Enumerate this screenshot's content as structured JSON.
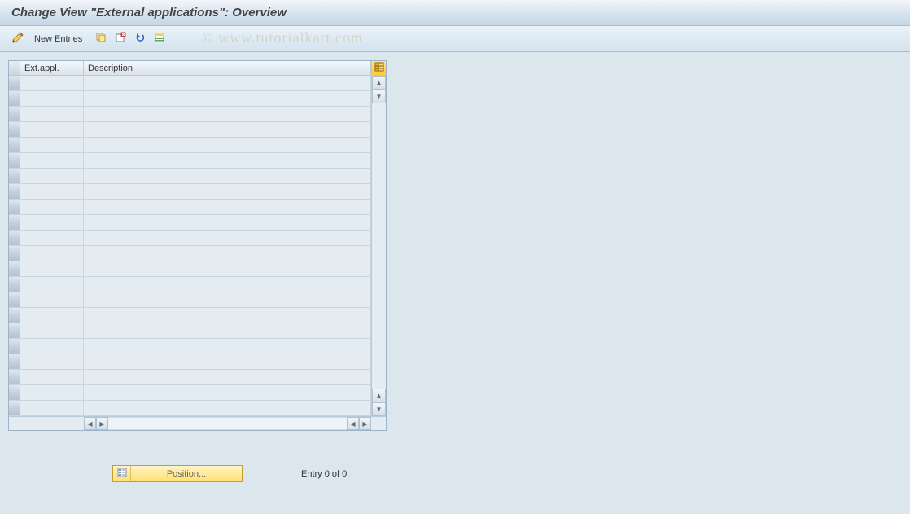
{
  "title": "Change View \"External applications\": Overview",
  "toolbar": {
    "new_entries_label": "New Entries",
    "icons": {
      "edit": "edit-pencil-icon",
      "copy": "copy-icon",
      "delete": "delete-icon",
      "undo": "undo-icon",
      "select_all": "select-all-icon"
    }
  },
  "table": {
    "columns": {
      "ext_appl": "Ext.appl.",
      "description": "Description"
    },
    "rows": [
      {
        "ext_appl": "",
        "description": ""
      },
      {
        "ext_appl": "",
        "description": ""
      },
      {
        "ext_appl": "",
        "description": ""
      },
      {
        "ext_appl": "",
        "description": ""
      },
      {
        "ext_appl": "",
        "description": ""
      },
      {
        "ext_appl": "",
        "description": ""
      },
      {
        "ext_appl": "",
        "description": ""
      },
      {
        "ext_appl": "",
        "description": ""
      },
      {
        "ext_appl": "",
        "description": ""
      },
      {
        "ext_appl": "",
        "description": ""
      },
      {
        "ext_appl": "",
        "description": ""
      },
      {
        "ext_appl": "",
        "description": ""
      },
      {
        "ext_appl": "",
        "description": ""
      },
      {
        "ext_appl": "",
        "description": ""
      },
      {
        "ext_appl": "",
        "description": ""
      },
      {
        "ext_appl": "",
        "description": ""
      },
      {
        "ext_appl": "",
        "description": ""
      },
      {
        "ext_appl": "",
        "description": ""
      },
      {
        "ext_appl": "",
        "description": ""
      },
      {
        "ext_appl": "",
        "description": ""
      },
      {
        "ext_appl": "",
        "description": ""
      },
      {
        "ext_appl": "",
        "description": ""
      }
    ]
  },
  "footer": {
    "position_label": "Position...",
    "entry_text": "Entry 0 of 0"
  },
  "watermark": "© www.tutorialkart.com"
}
